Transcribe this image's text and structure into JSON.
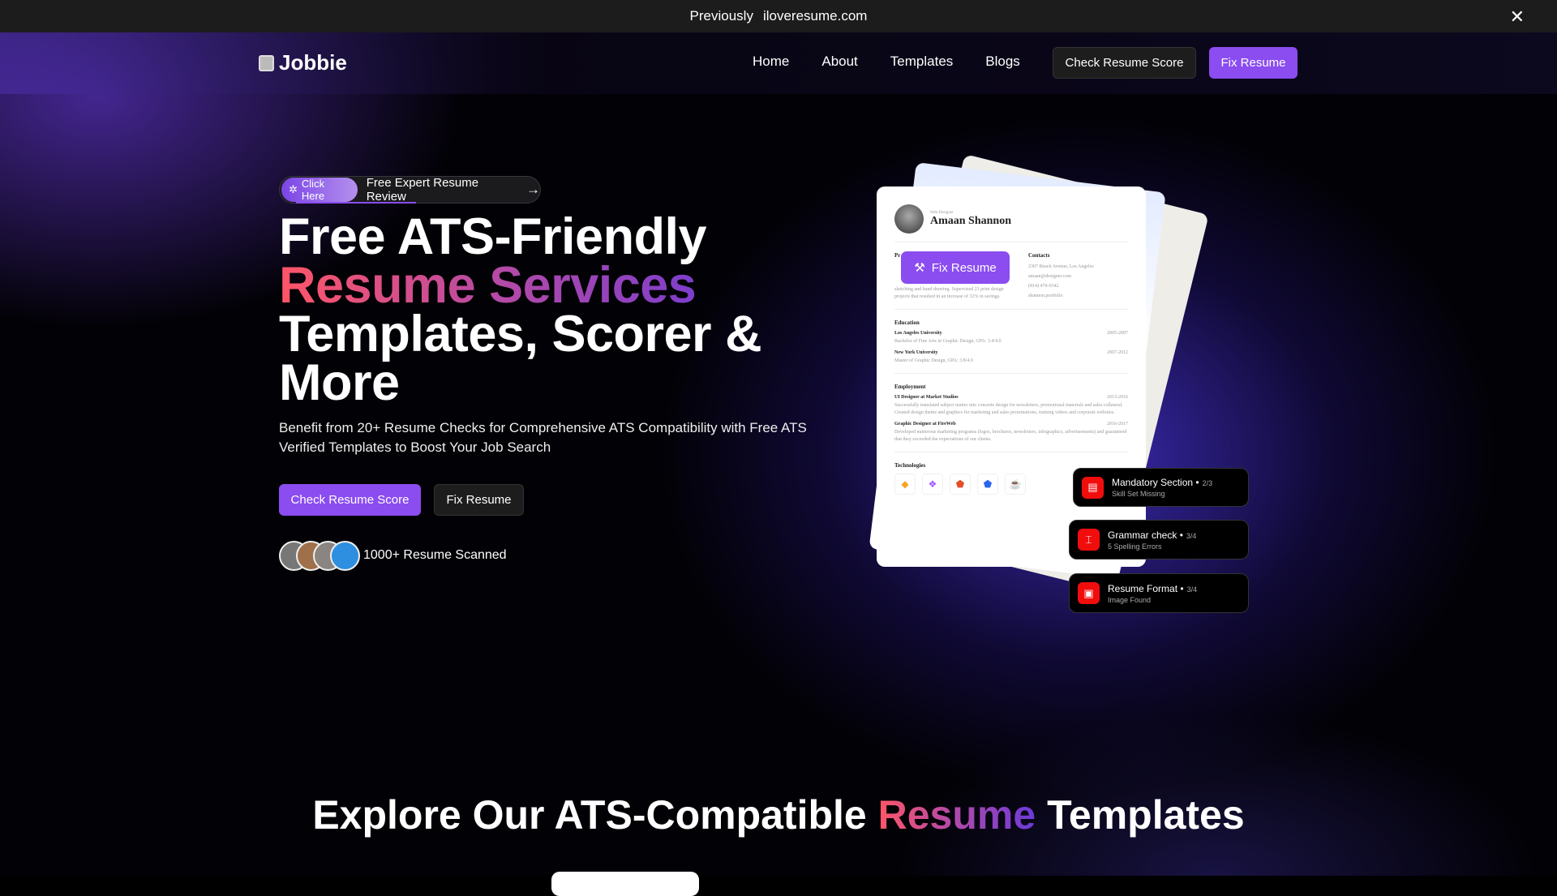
{
  "topbar": {
    "prefix": "Previously",
    "domain": "iloveresume.com",
    "close_icon": "close-icon"
  },
  "nav": {
    "logo": "Jobbie",
    "links": [
      "Home",
      "About",
      "Templates",
      "Blogs"
    ],
    "check_score": "Check Resume Score",
    "fix_resume": "Fix Resume"
  },
  "hero": {
    "pill_tag": "Click Here",
    "pill_text": "Free Expert Resume Review",
    "line1": "Free ATS-Friendly",
    "line2": "Resume Services",
    "line3": "Templates, Scorer &",
    "line4": "More",
    "description": "Benefit from 20+ Resume Checks for Comprehensive ATS Compatibility with Free ATS Verified Templates to Boost Your Job Search",
    "cta_primary": "Check Resume Score",
    "cta_secondary": "Fix Resume",
    "social_proof": "1000+ Resume Scanned"
  },
  "resume": {
    "role": "Web-Designer",
    "name": "Amaan Shannon",
    "overlay_button": "Fix Resume",
    "profile_heading": "Pr",
    "profile_text": "sketching and hand drawing. Supervised 23 print design projects that resulted in an increase of 32% in savings.",
    "contacts_heading": "Contacts",
    "contacts": [
      "2307 Beach Avenue, Los Angeles",
      "amaan@designer.com",
      "(814) 470-0342",
      "shannon.portfolio"
    ],
    "education_heading": "Education",
    "education": [
      {
        "school": "Los Angeles University",
        "years": "2005-2007",
        "detail": "Bachelor of Fine Arts in Graphic Design, GPA: 3.4/4.0"
      },
      {
        "school": "New York University",
        "years": "2007-2012",
        "detail": "Master of Graphic Design, GPA: 3.8/4.0"
      }
    ],
    "employment_heading": "Employment",
    "employment": [
      {
        "title": "UI Designer at Market Studios",
        "years": "2013-2016",
        "detail": "Successfully translated subject matter into concrete design for newsletters, promotional materials and sales collateral. Created design theme and graphics for marketing and sales presentations, training videos and corporate websites."
      },
      {
        "title": "Graphic Designer at FireWeb",
        "years": "2016-2017",
        "detail": "Developed numerous marketing programs (logos, brochures, newsletters, infographics, advertisements) and guaranteed that they exceeded the expectations of our clients."
      }
    ],
    "technologies_heading": "Technologies",
    "technologies": [
      "sketch-icon",
      "figma-icon",
      "html5-icon",
      "css3-icon",
      "java-icon"
    ]
  },
  "checks": [
    {
      "title": "Mandatory Section",
      "score": "2/3",
      "subtitle": "Skill Set Missing",
      "icon": "layout-icon"
    },
    {
      "title": "Grammar check",
      "score": "3/4",
      "subtitle": "5 Spelling Errors",
      "icon": "text-cursor-icon"
    },
    {
      "title": "Resume Format",
      "score": "3/4",
      "subtitle": "Image Found",
      "icon": "file-image-icon"
    }
  ],
  "section": {
    "pre": "Explore Our ATS-Compatible",
    "highlight": "Resume",
    "post": "Templates"
  },
  "colors": {
    "accent": "#8b4cf0",
    "alert": "#f20d0d",
    "gradient_start": "#ff5567",
    "gradient_end": "#6b3ad8"
  }
}
